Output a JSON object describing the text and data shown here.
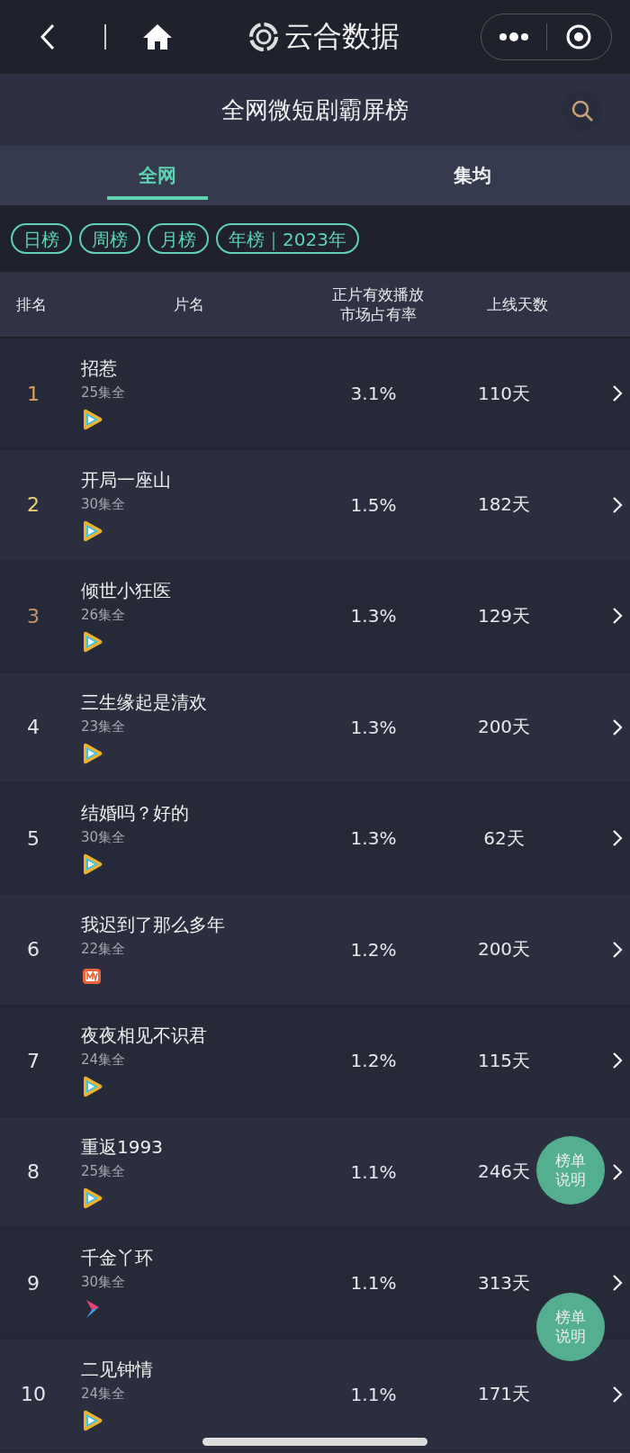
{
  "nav": {
    "app_name": "云合数据"
  },
  "header": {
    "title": "全网微短剧霸屏榜"
  },
  "tabs": [
    {
      "label": "全网",
      "selected": true
    },
    {
      "label": "集均",
      "selected": false
    }
  ],
  "filters": [
    {
      "label": "日榜"
    },
    {
      "label": "周榜"
    },
    {
      "label": "月榜"
    },
    {
      "label": "年榜｜2023年"
    }
  ],
  "table": {
    "columns": [
      {
        "label": "排名"
      },
      {
        "label": "片名"
      },
      {
        "label": "正片有效播放市场占有率"
      },
      {
        "label": "上线天数"
      }
    ],
    "rows": [
      {
        "rank": "1",
        "color": "#e0a35a",
        "title": "招惹",
        "episodes": "25集全",
        "kind": "play",
        "share": "3.1%",
        "days": "110天"
      },
      {
        "rank": "2",
        "color": "#f2d27a",
        "title": "开局一座山",
        "episodes": "30集全",
        "kind": "play",
        "share": "1.5%",
        "days": "182天"
      },
      {
        "rank": "3",
        "color": "#c4967a",
        "title": "倾世小狂医",
        "episodes": "26集全",
        "kind": "play",
        "share": "1.3%",
        "days": "129天"
      },
      {
        "rank": "4",
        "color": "#e6e6ea",
        "title": "三生缘起是清欢",
        "episodes": "23集全",
        "kind": "play",
        "share": "1.3%",
        "days": "200天"
      },
      {
        "rank": "5",
        "color": "#e6e6ea",
        "title": "结婚吗？好的",
        "episodes": "30集全",
        "kind": "play",
        "share": "1.3%",
        "days": "62天"
      },
      {
        "rank": "6",
        "color": "#e6e6ea",
        "title": "我迟到了那么多年",
        "episodes": "22集全",
        "kind": "tv",
        "share": "1.2%",
        "days": "200天"
      },
      {
        "rank": "7",
        "color": "#e6e6ea",
        "title": "夜夜相见不识君",
        "episodes": "24集全",
        "kind": "play",
        "share": "1.2%",
        "days": "115天"
      },
      {
        "rank": "8",
        "color": "#e6e6ea",
        "title": "重返1993",
        "episodes": "25集全",
        "kind": "play",
        "share": "1.1%",
        "days": "246天"
      },
      {
        "rank": "9",
        "color": "#e6e6ea",
        "title": "千金丫环",
        "episodes": "30集全",
        "kind": "ribbon",
        "share": "1.1%",
        "days": "313天"
      },
      {
        "rank": "10",
        "color": "#e6e6ea",
        "title": "二见钟情",
        "episodes": "24集全",
        "kind": "play",
        "share": "1.1%",
        "days": "171天"
      }
    ]
  },
  "floating_buttons": [
    {
      "label": "榜单说明"
    },
    {
      "label": "榜单说明"
    }
  ]
}
